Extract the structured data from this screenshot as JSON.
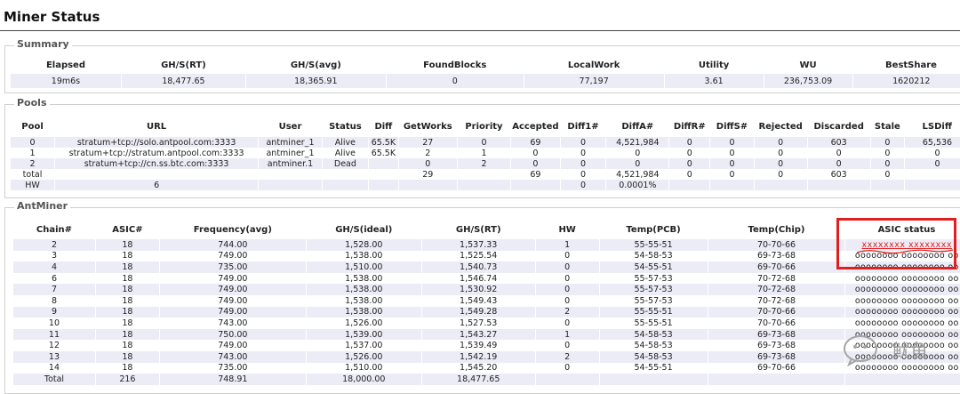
{
  "page": {
    "title": "Miner Status"
  },
  "summary": {
    "legend": "Summary",
    "headers": [
      "Elapsed",
      "GH/S(RT)",
      "GH/S(avg)",
      "FoundBlocks",
      "LocalWork",
      "Utility",
      "WU",
      "BestShare"
    ],
    "row": [
      "19m6s",
      "18,477.65",
      "18,365.91",
      "0",
      "77,197",
      "3.61",
      "236,753.09",
      "1620212"
    ]
  },
  "pools": {
    "legend": "Pools",
    "headers": [
      "Pool",
      "URL",
      "User",
      "Status",
      "Diff",
      "GetWorks",
      "Priority",
      "Accepted",
      "Diff1#",
      "DiffA#",
      "DiffR#",
      "DiffS#",
      "Rejected",
      "Discarded",
      "Stale",
      "LSDiff"
    ],
    "rows": [
      [
        "0",
        "stratum+tcp://solo.antpool.com:3333",
        "antminer_1",
        "Alive",
        "65.5K",
        "27",
        "0",
        "69",
        "0",
        "4,521,984",
        "0",
        "0",
        "0",
        "603",
        "0",
        "65,536"
      ],
      [
        "1",
        "stratum+tcp://stratum.antpool.com:3333",
        "antminer_1",
        "Alive",
        "65.5K",
        "2",
        "1",
        "0",
        "0",
        "0",
        "0",
        "0",
        "0",
        "0",
        "0",
        "0"
      ],
      [
        "2",
        "stratum+tcp://cn.ss.btc.com:3333",
        "antminer.1",
        "Dead",
        "",
        "0",
        "2",
        "0",
        "0",
        "0",
        "0",
        "0",
        "0",
        "0",
        "0",
        "0"
      ],
      [
        "total",
        "",
        "",
        "",
        "",
        "29",
        "",
        "69",
        "0",
        "4,521,984",
        "0",
        "0",
        "0",
        "603",
        "0",
        ""
      ],
      [
        "HW",
        "6",
        "",
        "",
        "",
        "",
        "",
        "",
        "0",
        "0.0001%",
        "",
        "",
        "",
        "",
        "",
        ""
      ]
    ]
  },
  "antminer": {
    "legend": "AntMiner",
    "headers": [
      "Chain#",
      "ASIC#",
      "Frequency(avg)",
      "GH/S(ideal)",
      "GH/S(RT)",
      "HW",
      "Temp(PCB)",
      "Temp(Chip)",
      "ASIC status"
    ],
    "rows": [
      [
        "2",
        "18",
        "744.00",
        "1,528.00",
        "1,537.33",
        "1",
        "55-55-51",
        "70-70-66",
        "xxxxxxxx xxxxxxxx"
      ],
      [
        "3",
        "18",
        "749.00",
        "1,538.00",
        "1,525.54",
        "0",
        "54-58-53",
        "69-73-68",
        "oooooooo oooooooo oo"
      ],
      [
        "4",
        "18",
        "735.00",
        "1,510.00",
        "1,540.73",
        "0",
        "54-55-51",
        "69-70-66",
        "oooooooo oooooooo oo"
      ],
      [
        "6",
        "18",
        "749.00",
        "1,538.00",
        "1,546.74",
        "0",
        "55-57-53",
        "70-72-68",
        "oooooooo oooooooo oo"
      ],
      [
        "7",
        "18",
        "749.00",
        "1,538.00",
        "1,530.92",
        "0",
        "55-57-53",
        "70-72-68",
        "oooooooo oooooooo oo"
      ],
      [
        "8",
        "18",
        "749.00",
        "1,538.00",
        "1,549.43",
        "0",
        "55-57-53",
        "70-72-68",
        "oooooooo oooooooo oo"
      ],
      [
        "9",
        "18",
        "749.00",
        "1,538.00",
        "1,549.28",
        "2",
        "55-55-51",
        "70-70-66",
        "oooooooo oooooooo oo"
      ],
      [
        "10",
        "18",
        "743.00",
        "1,526.00",
        "1,527.53",
        "0",
        "55-55-51",
        "70-70-66",
        "oooooooo oooooooo oo"
      ],
      [
        "11",
        "18",
        "750.00",
        "1,539.00",
        "1,543.27",
        "1",
        "54-58-53",
        "69-73-68",
        "oooooooo oooooooo oo"
      ],
      [
        "12",
        "18",
        "749.00",
        "1,537.00",
        "1,539.49",
        "0",
        "54-58-53",
        "69-73-68",
        "oooooooo oooooooo oo"
      ],
      [
        "13",
        "18",
        "743.00",
        "1,526.00",
        "1,542.19",
        "2",
        "54-58-53",
        "69-73-68",
        "oooooooo oooooooo oo"
      ],
      [
        "14",
        "18",
        "735.00",
        "1,510.00",
        "1,545.20",
        "0",
        "54-55-51",
        "69-70-66",
        "oooooooo oooooooo oo"
      ],
      [
        "Total",
        "216",
        "748.91",
        "18,000.00",
        "18,477.65",
        "",
        "",
        "",
        ""
      ]
    ]
  },
  "annotation": {
    "highlight_color": "#e0201f",
    "watermark_text": "鱿鱼",
    "watermark_icon": "wechat-icon"
  }
}
